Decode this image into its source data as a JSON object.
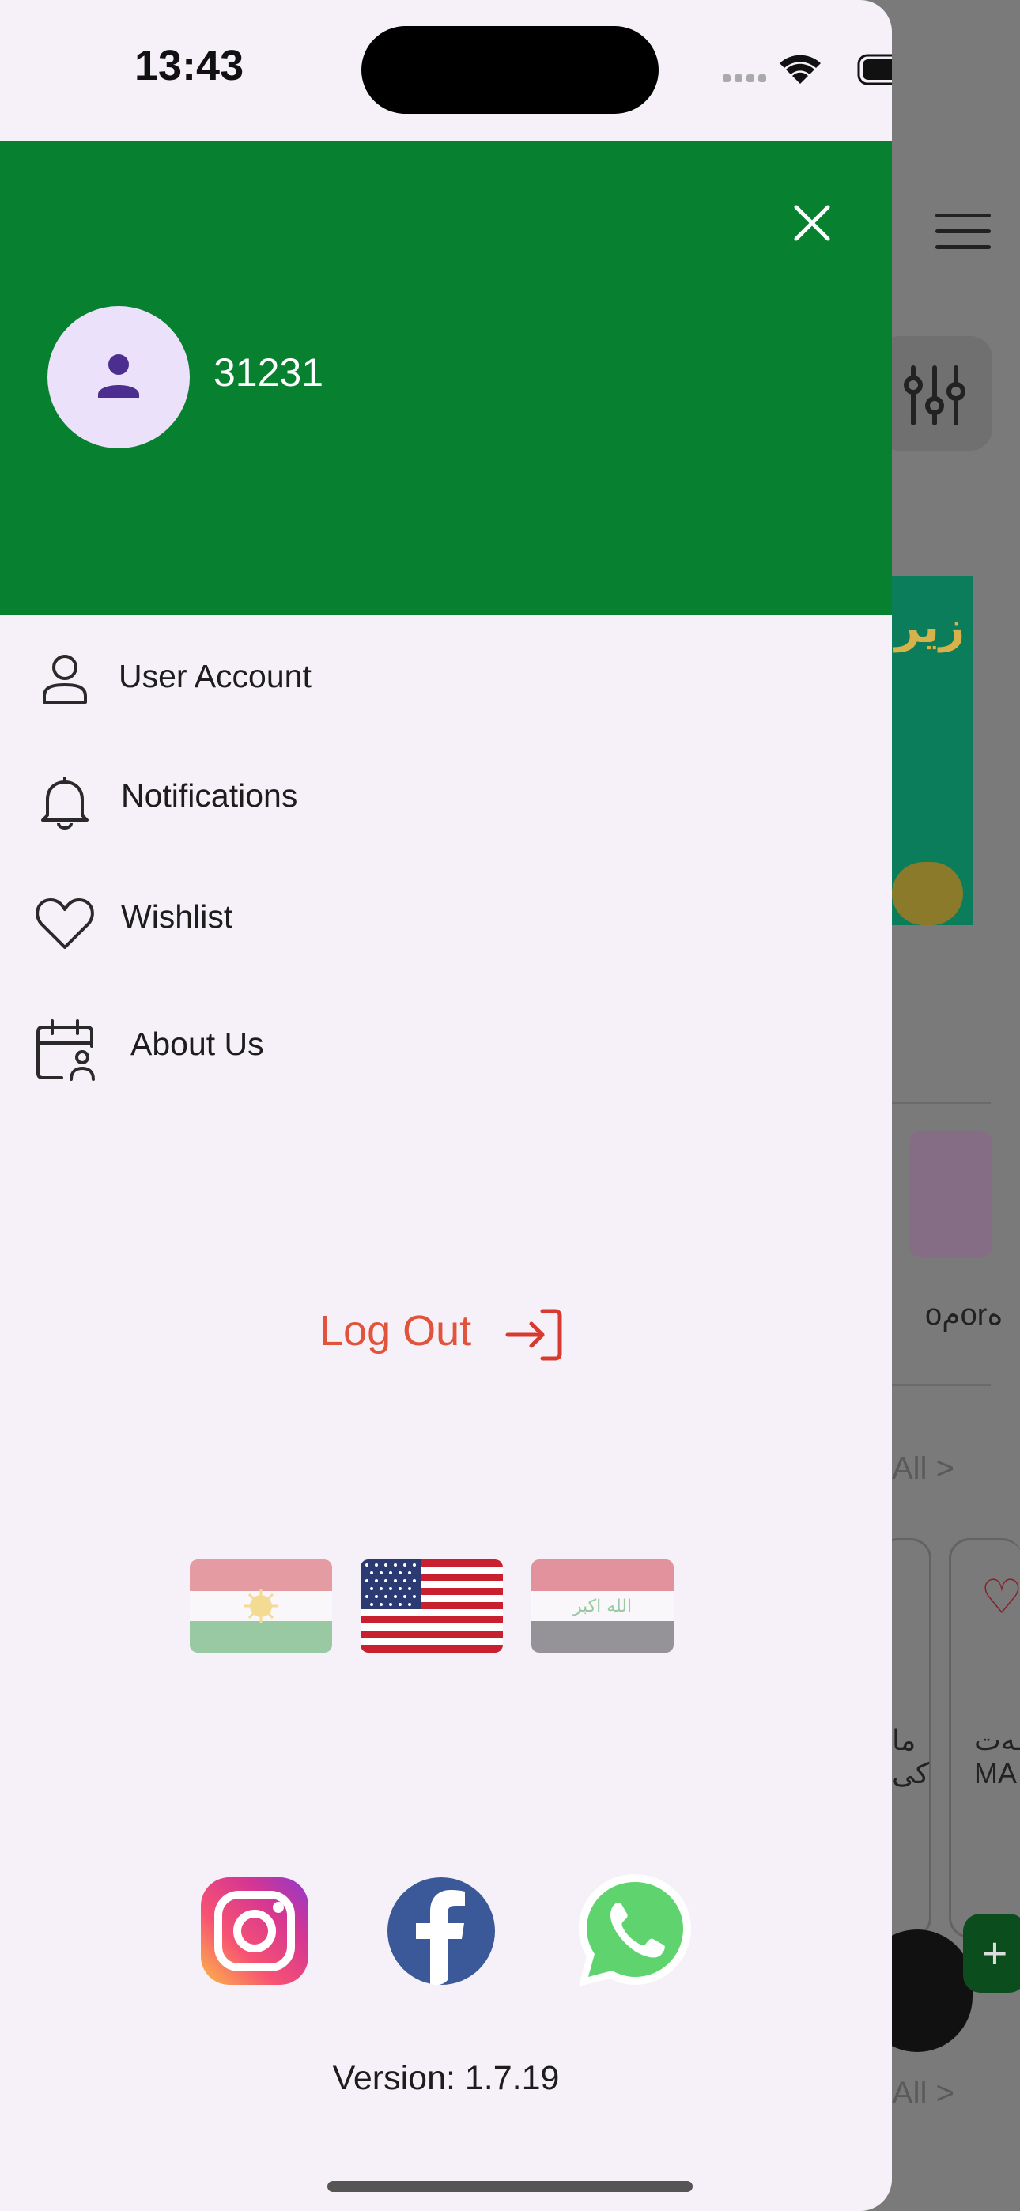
{
  "status_bar": {
    "time": "13:43"
  },
  "drawer": {
    "user": {
      "id": "31231"
    },
    "menu": [
      {
        "label": "User Account",
        "icon": "user-icon"
      },
      {
        "label": "Notifications",
        "icon": "bell-icon"
      },
      {
        "label": "Wishlist",
        "icon": "heart-icon"
      },
      {
        "label": "About Us",
        "icon": "calendar-user-icon"
      }
    ],
    "logout_label": "Log Out",
    "languages": [
      {
        "name": "Kurdistan flag",
        "icon": "kurdistan-flag-icon",
        "selected": false
      },
      {
        "name": "United States flag",
        "icon": "us-flag-icon",
        "selected": true
      },
      {
        "name": "Iraq flag",
        "icon": "iraq-flag-icon",
        "selected": false
      }
    ],
    "iraq_flag_text": "الله اكبر",
    "social": [
      {
        "name": "Instagram",
        "icon": "instagram-icon"
      },
      {
        "name": "Facebook",
        "icon": "facebook-icon"
      },
      {
        "name": "WhatsApp",
        "icon": "whatsapp-icon"
      }
    ],
    "version": "Version: 1.7.19"
  },
  "background_app": {
    "banner_text": "زیر",
    "category_text": "oمorه",
    "see_all_1": "All  >",
    "see_all_2": "All  >",
    "card_text_1": "ما\nکی",
    "card_text_2": "ـەت\nMA",
    "add_label": "+"
  },
  "colors": {
    "header_green": "#07812f",
    "drawer_bg": "#f6f1f8",
    "logout_red": "#e2533c",
    "avatar_bg": "#ece1fb",
    "avatar_icon": "#4b2e8f"
  }
}
